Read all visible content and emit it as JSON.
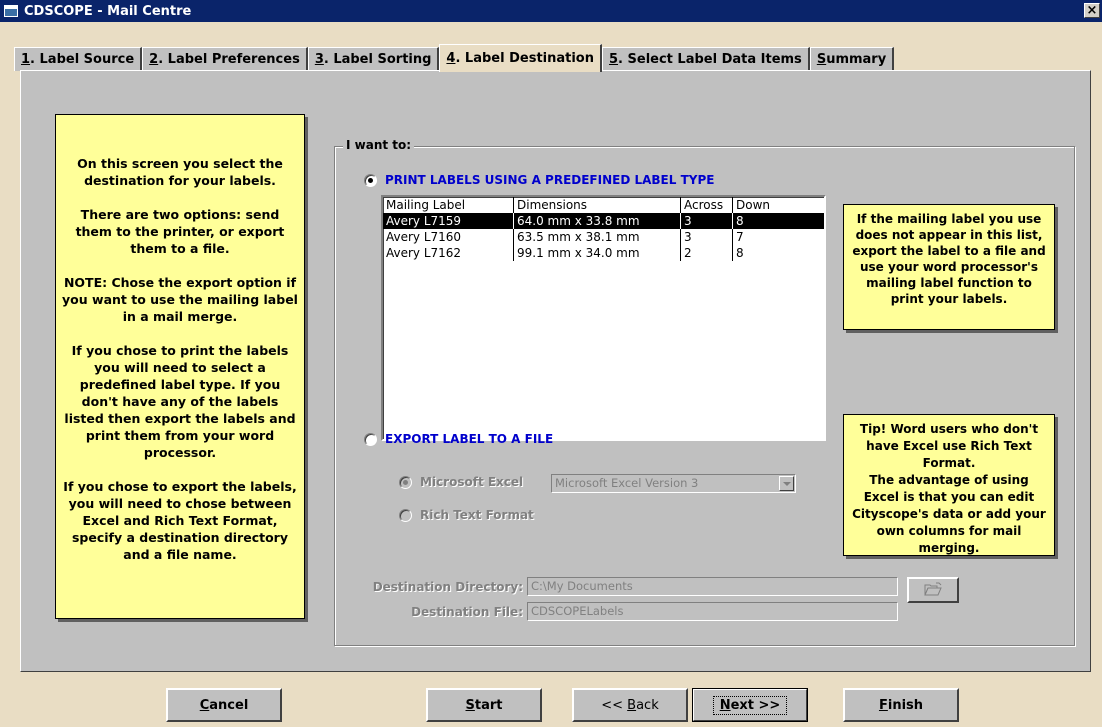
{
  "window": {
    "title": "CDSCOPE - Mail Centre",
    "close_label": "×"
  },
  "tabs": [
    {
      "num": "1",
      "rest": ". Label Source"
    },
    {
      "num": "2",
      "rest": ". Label Preferences"
    },
    {
      "num": "3",
      "rest": ". Label Sorting"
    },
    {
      "num": "4",
      "rest": ". Label Destination"
    },
    {
      "num": "5",
      "rest": ". Select Label Data Items"
    },
    {
      "num": "S",
      "rest": "ummary"
    }
  ],
  "active_tab": "4. Label Destination",
  "left_info": {
    "paragraphs": [
      "On this screen you select the destination for your labels.",
      "There are two options: send them to the printer, or export them to a file.",
      "NOTE: Chose the export option if you want to use the mailing label in a mail merge.",
      "If you chose to print the labels you will need to select a predefined label type. If you don't have any of the labels listed then export the labels and print them from your word processor.",
      "If you chose to export the labels, you will need to chose between Excel and Rich Text Format, specify a destination directory and a file name."
    ]
  },
  "group": {
    "legend": "I want to:",
    "option_print": "PRINT LABELS USING A PREDEFINED LABEL TYPE",
    "option_export": "EXPORT LABEL TO A FILE",
    "print_selected": true
  },
  "label_list": {
    "headers": [
      "Mailing Label",
      "Dimensions",
      "Across",
      "Down"
    ],
    "rows": [
      [
        "Avery L7159",
        "64.0 mm x 33.8 mm",
        "3",
        "8"
      ],
      [
        "Avery L7160",
        "63.5 mm x 38.1 mm",
        "3",
        "7"
      ],
      [
        "Avery L7162",
        "99.1 mm x 34.0 mm",
        "2",
        "8"
      ]
    ],
    "selected_row": 0
  },
  "export": {
    "excel_label": "Microsoft Excel",
    "excel_version": "Microsoft Excel Version 3",
    "rtf_label": "Rich Text Format",
    "excel_selected": true
  },
  "destination": {
    "dir_label": "Destination Directory:",
    "dir_value": "C:\\My Documents",
    "file_label": "Destination File:",
    "file_value": "CDSCOPELabels"
  },
  "tip1": "If the mailing label you use does not appear in this list, export the label to a file and use your word processor's mailing label function to print your labels.",
  "tip2": "Tip! Word users who don't have Excel use Rich Text Format.\nThe advantage of using Excel is that you can edit Cityscope's data or add your own columns for mail merging.",
  "buttons": {
    "cancel": {
      "u": "C",
      "rest": "ancel"
    },
    "start": {
      "u": "S",
      "rest": "tart"
    },
    "back": {
      "pre": "<< ",
      "u": "B",
      "rest": "ack"
    },
    "next": {
      "u": "N",
      "rest": "ext >>"
    },
    "finish": {
      "u": "F",
      "rest": "inish"
    }
  },
  "colors": {
    "title_bar": "#0a246a",
    "info_bg": "#ffff99",
    "option_text": "#0000cc",
    "panel": "#c0c0c0"
  }
}
